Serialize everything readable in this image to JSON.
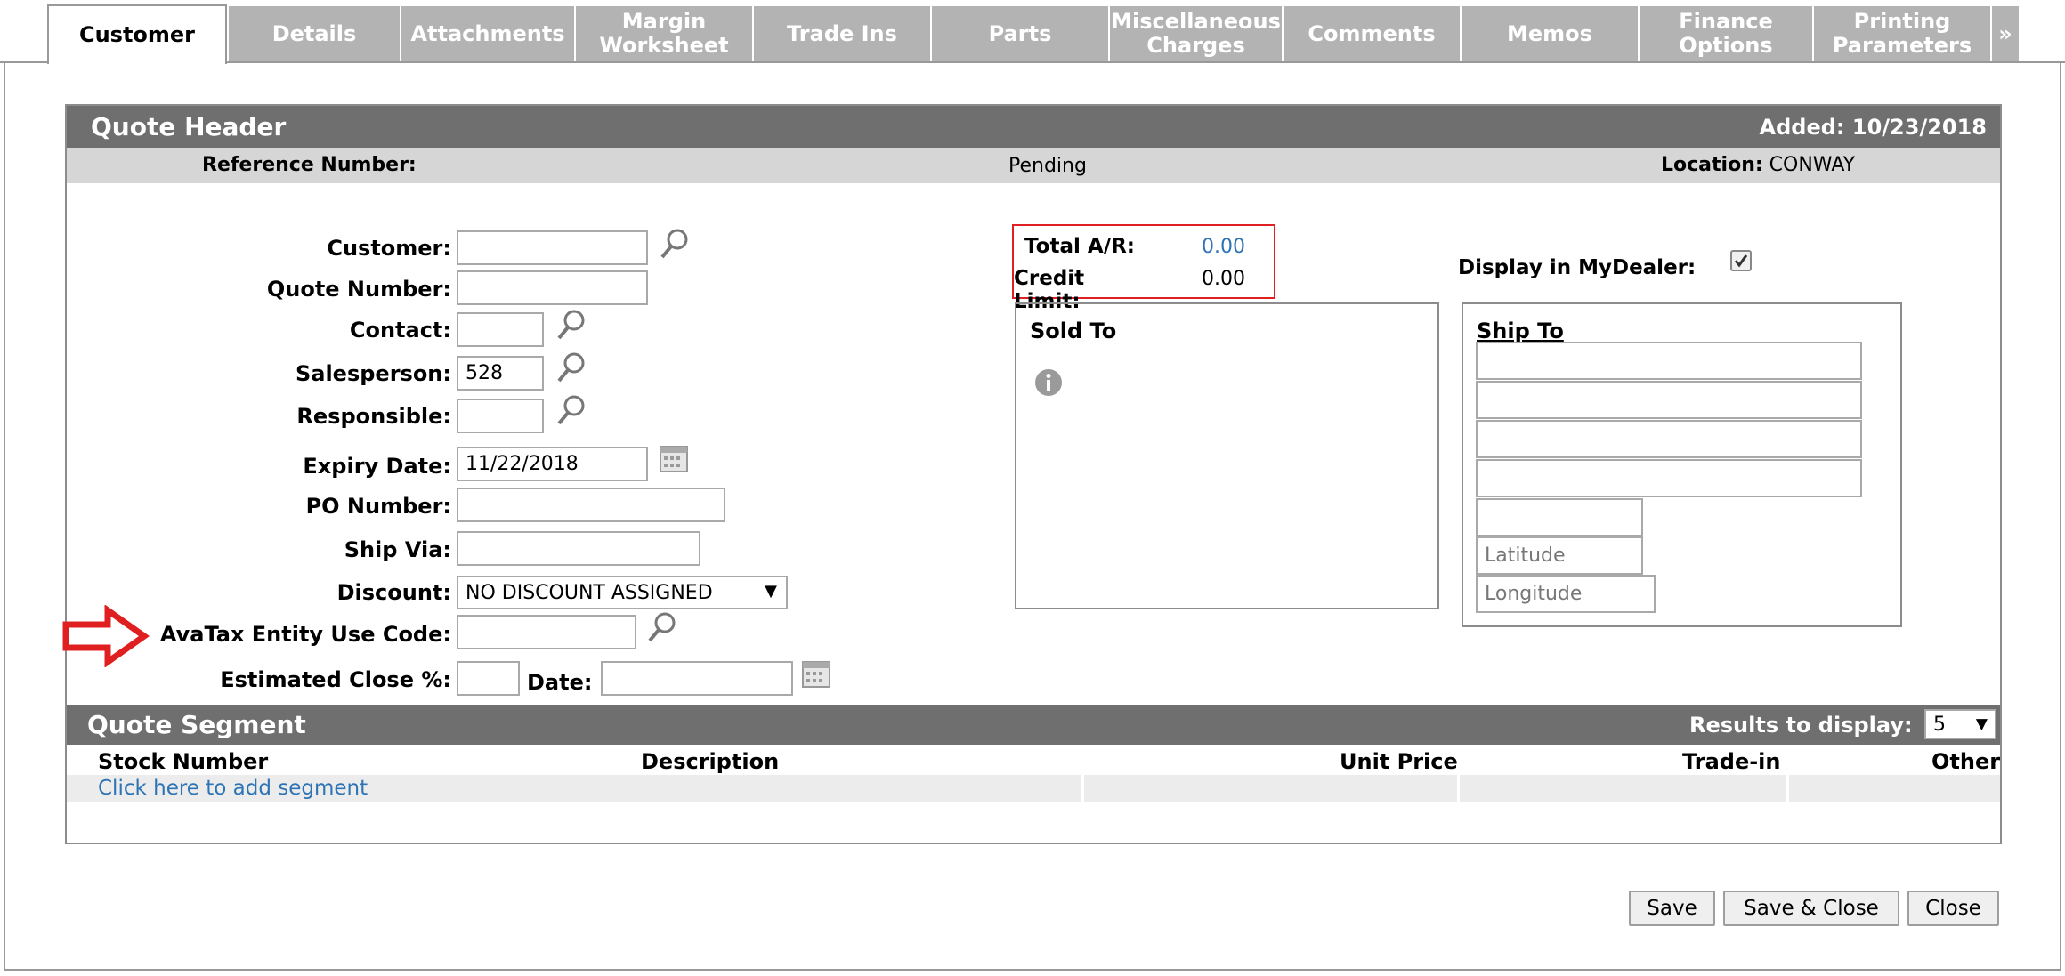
{
  "tabs": [
    {
      "label": "Customer"
    },
    {
      "label": "Details"
    },
    {
      "label": "Attachments"
    },
    {
      "label": "Margin\nWorksheet"
    },
    {
      "label": "Trade Ins"
    },
    {
      "label": "Parts"
    },
    {
      "label": "Miscellaneous\nCharges"
    },
    {
      "label": "Comments"
    },
    {
      "label": "Memos"
    },
    {
      "label": "Finance\nOptions"
    },
    {
      "label": "Printing\nParameters"
    }
  ],
  "tab_more": "»",
  "quote_header": {
    "title": "Quote Header",
    "added": "Added: 10/23/2018",
    "reference_label": "Reference Number:",
    "status": "Pending",
    "location_label": "Location:",
    "location_value": "CONWAY"
  },
  "form": {
    "customer_label": "Customer:",
    "customer_value": "",
    "quote_number_label": "Quote Number:",
    "quote_number_value": "",
    "contact_label": "Contact:",
    "contact_value": "",
    "salesperson_label": "Salesperson:",
    "salesperson_value": "528",
    "responsible_label": "Responsible:",
    "responsible_value": "",
    "expiry_label": "Expiry Date:",
    "expiry_value": "11/22/2018",
    "po_label": "PO Number:",
    "po_value": "",
    "ship_via_label": "Ship Via:",
    "ship_via_value": "",
    "discount_label": "Discount:",
    "discount_value": "NO DISCOUNT ASSIGNED",
    "avatax_label": "AvaTax Entity Use Code:",
    "avatax_value": "",
    "est_close_label": "Estimated Close %:",
    "est_close_value": "",
    "date_label": "Date:",
    "date_value": ""
  },
  "ar": {
    "total_label": "Total A/R:",
    "total_value": "0.00",
    "credit_label": "Credit Limit:",
    "credit_value": "0.00"
  },
  "display_mydealer_label": "Display in MyDealer:",
  "display_mydealer_checked": true,
  "sold_to": {
    "title": "Sold To"
  },
  "ship_to": {
    "title": "Ship To",
    "latitude_placeholder": "Latitude",
    "longitude_placeholder": "Longitude"
  },
  "quote_segment": {
    "title": "Quote Segment",
    "results_label": "Results to display:",
    "results_value": "5",
    "columns": [
      "Stock Number",
      "Description",
      "Unit Price",
      "Trade-in",
      "Other"
    ],
    "add_link": "Click here to add segment"
  },
  "buttons": {
    "save": "Save",
    "save_close": "Save & Close",
    "close": "Close"
  },
  "colors": {
    "accent_red": "#e02020",
    "header_bar": "#6f6f6f",
    "link_blue": "#2e74b5"
  }
}
